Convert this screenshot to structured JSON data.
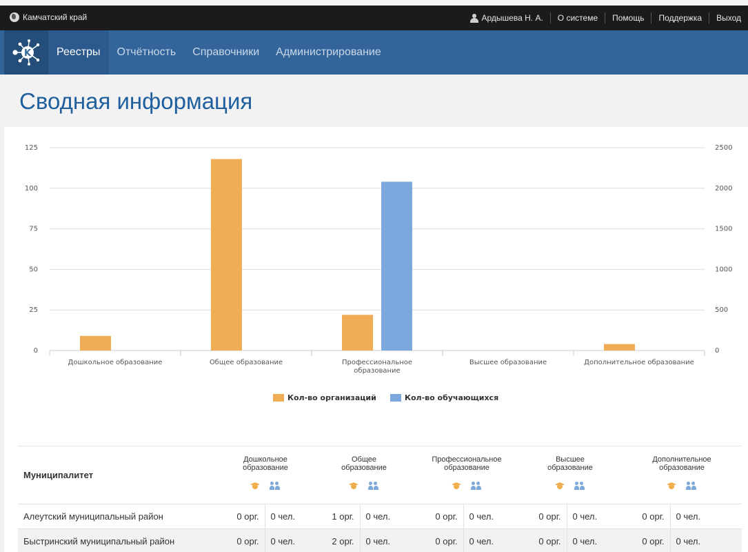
{
  "topbar": {
    "region": "Камчатский край",
    "user": "Ардышева Н. А.",
    "links": [
      "О системе",
      "Помощь",
      "Поддержка",
      "Выход"
    ]
  },
  "nav": {
    "items": [
      "Реестры",
      "Отчётность",
      "Справочники",
      "Администрирование"
    ],
    "active": "Реестры"
  },
  "page_title": "Сводная информация",
  "chart_data": {
    "type": "bar",
    "categories": [
      "Дошкольное образование",
      "Общее образование",
      "Профессиональное образование",
      "Высшее образование",
      "Дополнительное образование"
    ],
    "category_lines": [
      [
        "Дошкольное образование"
      ],
      [
        "Общее образование"
      ],
      [
        "Профессиональное",
        "образование"
      ],
      [
        "Высшее образование"
      ],
      [
        "Дополнительное образование"
      ]
    ],
    "series": [
      {
        "name": "Кол-во организаций",
        "values": [
          9,
          118,
          22,
          0,
          4
        ],
        "axis": "left",
        "color": "#f0ad56"
      },
      {
        "name": "Кол-во обучающихся",
        "values": [
          0,
          0,
          2080,
          0,
          0
        ],
        "axis": "right",
        "color": "#7ba9dd"
      }
    ],
    "ylim_left": [
      0,
      125
    ],
    "yticks_left": [
      "0",
      "25",
      "50",
      "75",
      "100",
      "125"
    ],
    "ylim_right": [
      0,
      2500
    ],
    "yticks_right": [
      "0",
      "500",
      "1000",
      "1500",
      "2000",
      "2500"
    ],
    "grid": true,
    "legend": "bottom-center"
  },
  "table": {
    "col_muni": "Муниципалитет",
    "categories": [
      [
        "Дошкольное",
        "образование"
      ],
      [
        "Общее",
        "образование"
      ],
      [
        "Профессиональное",
        "образование"
      ],
      [
        "Высшее",
        "образование"
      ],
      [
        "Дополнительное",
        "образование"
      ]
    ],
    "rows": [
      {
        "name": "Алеутский муниципальный район",
        "cells": [
          [
            "0 орг.",
            "0 чел."
          ],
          [
            "1 орг.",
            "0 чел."
          ],
          [
            "0 орг.",
            "0 чел."
          ],
          [
            "0 орг.",
            "0 чел."
          ],
          [
            "0 орг.",
            "0 чел."
          ]
        ]
      },
      {
        "name": "Быстринский муниципальный район",
        "cells": [
          [
            "0 орг.",
            "0 чел."
          ],
          [
            "2 орг.",
            "0 чел."
          ],
          [
            "0 орг.",
            "0 чел."
          ],
          [
            "0 орг.",
            "0 чел."
          ],
          [
            "0 орг.",
            "0 чел."
          ]
        ]
      }
    ]
  }
}
